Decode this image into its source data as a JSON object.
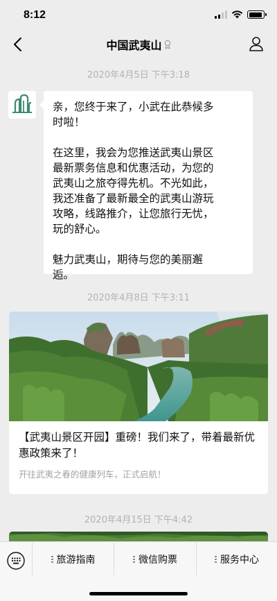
{
  "status_bar": {
    "time": "8:12",
    "battery_level": 0.9,
    "signal_bars": 2
  },
  "header": {
    "title": "中国武夷山",
    "back_icon": "chevron-left-icon",
    "profile_icon": "person-icon"
  },
  "messages": [
    {
      "timestamp": "2020年4月5日 下午3:18",
      "paragraphs": [
        "亲，您终于来了，小武在此恭候多\n时啦！",
        "在这里，我会为您推送武夷山景区\n最新票务信息和优惠活动，为您的\n武夷山之旅夺得先机。不光如此，\n我还准备了最新最全的武夷山游玩\n攻略，线路推介，让您旅行无忧，\n玩的舒心。",
        "魅力武夷山，期待与您的美丽邂\n逅。"
      ]
    },
    {
      "timestamp": "2020年4月8日 下午3:11",
      "article": {
        "title": "【武夷山景区开园】重磅！我们来了，带着最新优惠政策来了！",
        "summary": "开往武夷之春的健康列车，正式启航！"
      }
    },
    {
      "timestamp": "2020年4月15日 下午4:42"
    }
  ],
  "menu": {
    "keyboard_icon": "keyboard-icon",
    "items": [
      {
        "label": "旅游指南"
      },
      {
        "label": "微信购票"
      },
      {
        "label": "服务中心"
      }
    ]
  },
  "colors": {
    "background": "#ededed",
    "bubble": "#ffffff",
    "timestamp": "#b2b2b2",
    "menu_bg": "#f7f7f7",
    "avatar_logo": "#3f8a73"
  }
}
